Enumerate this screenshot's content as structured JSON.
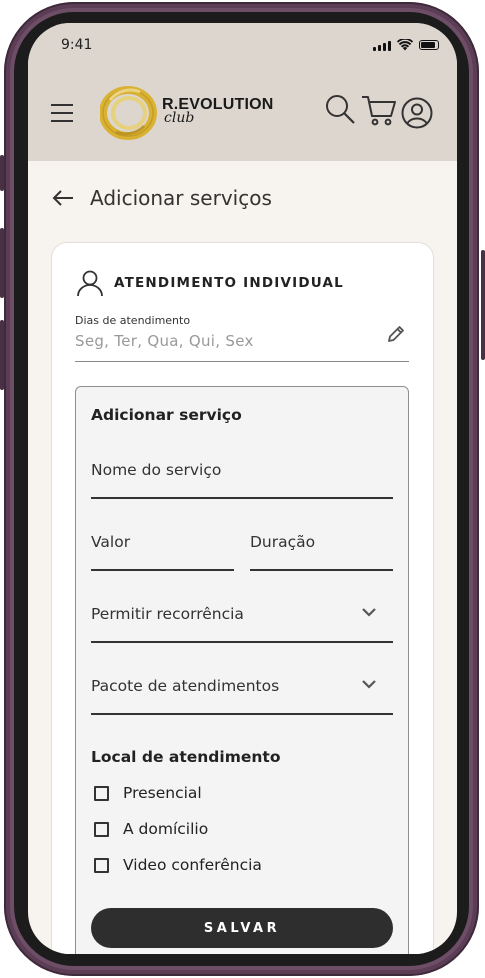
{
  "status_bar": {
    "time": "9:41"
  },
  "header": {
    "brand_name": "R.EVOLUTION",
    "brand_sub": "club",
    "colors": {
      "background": "#ddd6cf",
      "logo_gold": "#d9b233"
    }
  },
  "page": {
    "title": "Adicionar serviços"
  },
  "card": {
    "section_title": "ATENDIMENTO INDIVIDUAL",
    "days_label": "Dias de atendimento",
    "days_value": "Seg, Ter, Qua, Qui, Sex",
    "form": {
      "title": "Adicionar serviço",
      "service_name_placeholder": "Nome do serviço",
      "value_placeholder": "Valor",
      "duration_placeholder": "Duração",
      "recurrence_select": "Permitir recorrência",
      "package_select": "Pacote de atendimentos",
      "location_title": "Local de atendimento",
      "location_options": [
        {
          "label": "Presencial",
          "checked": false
        },
        {
          "label": "A domícilio",
          "checked": false
        },
        {
          "label": "Video conferência",
          "checked": false
        }
      ],
      "save_label": "SALVAR"
    }
  }
}
